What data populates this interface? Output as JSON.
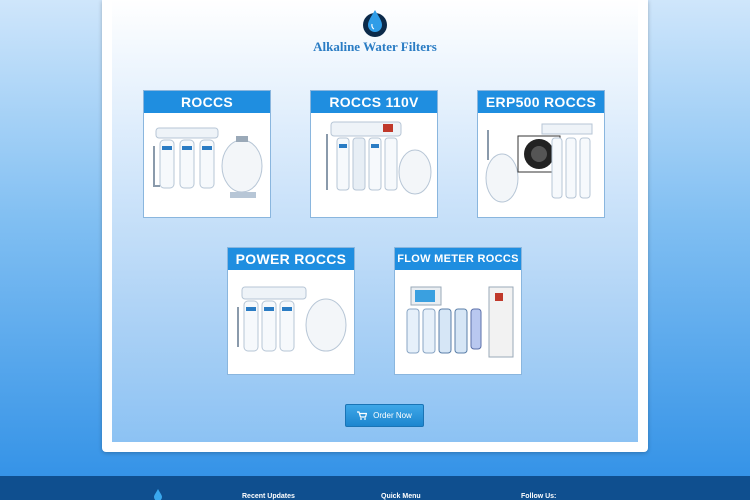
{
  "site": {
    "brand": "Alkaline Water Filters",
    "colors": {
      "accent": "#1f8ee0",
      "footer": "#0f4f8f",
      "brand_text": "#2a7cc4"
    }
  },
  "products": [
    {
      "label": "ROCCS"
    },
    {
      "label": "ROCCS 110V"
    },
    {
      "label": "ERP500 ROCCS"
    },
    {
      "label": "POWER ROCCS"
    },
    {
      "label": "FLOW METER ROCCS"
    }
  ],
  "order": {
    "label": "Order Now",
    "icon": "cart-icon"
  },
  "footer": {
    "columns": [
      {
        "title": "Recent Updates"
      },
      {
        "title": "Quick Menu"
      },
      {
        "title": "Follow Us:"
      }
    ]
  }
}
